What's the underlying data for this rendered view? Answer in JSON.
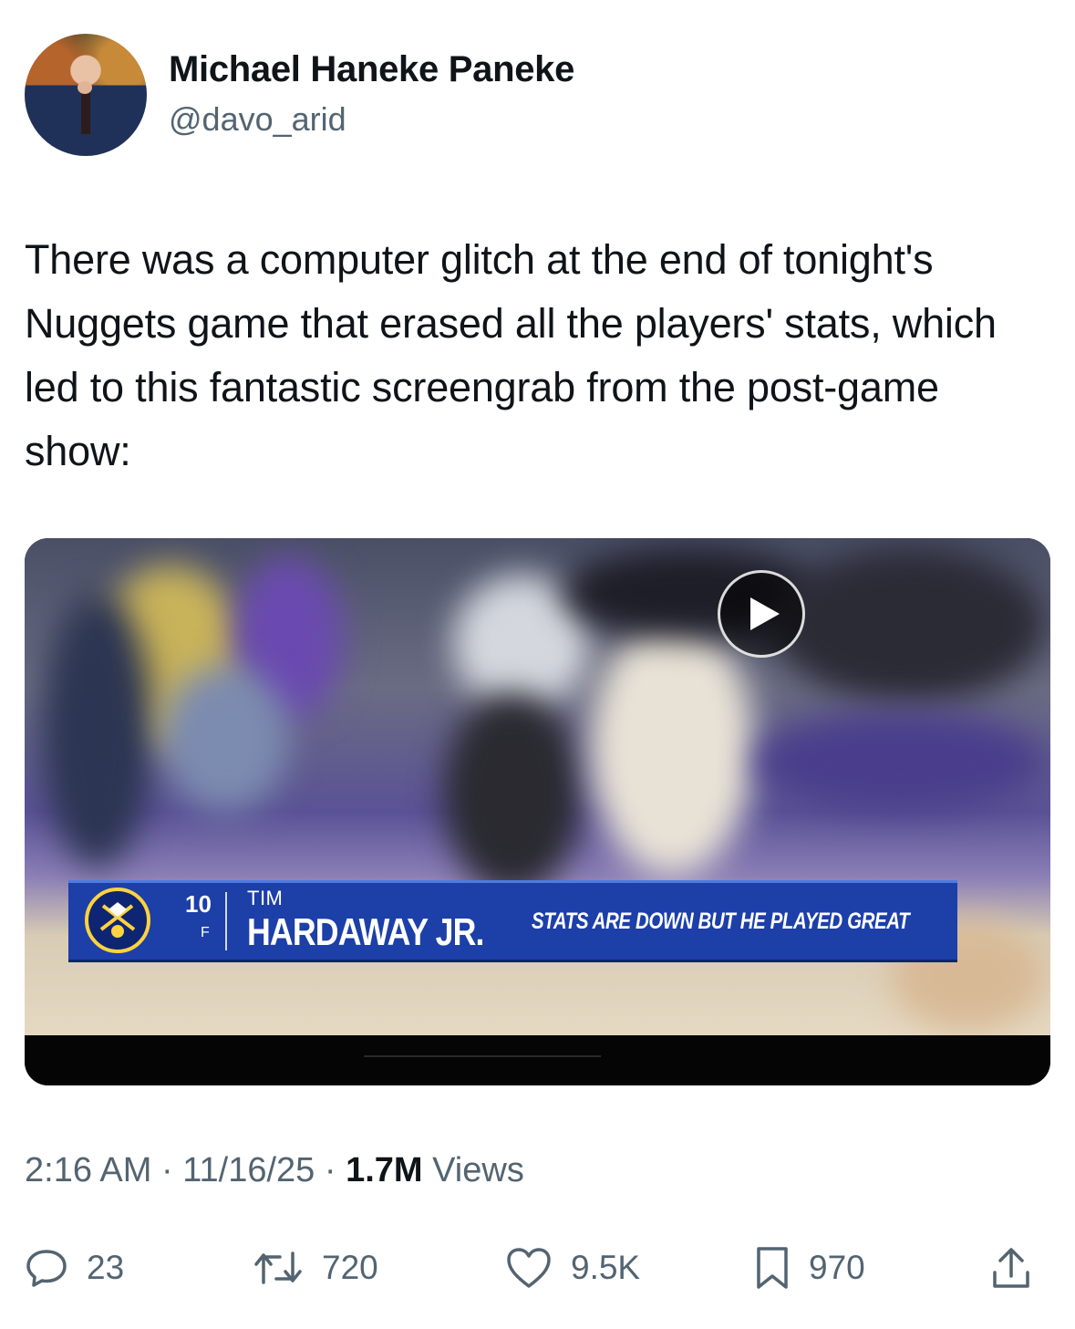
{
  "author": {
    "display_name": "Michael Haneke Paneke",
    "handle": "@davo_arid"
  },
  "tweet": {
    "text": "There was a computer glitch at the end of tonight's Nuggets game that erased all the players' stats, which led to this fantastic screengrab from the post-game show:"
  },
  "media": {
    "icon": "play-icon",
    "graphic": {
      "number": "10",
      "position": "F",
      "first_name": "TIM",
      "last_name": "HARDAWAY JR.",
      "message": "STATS ARE DOWN BUT HE PLAYED GREAT",
      "bar_color": "#1c3fa8",
      "logo_color": "#ffd23f"
    }
  },
  "meta": {
    "time": "2:16 AM",
    "sep1": " · ",
    "date": "11/16/25",
    "sep2": " · ",
    "views_count": "1.7M",
    "views_label": " Views"
  },
  "actions": {
    "reply_count": "23",
    "repost_count": "720",
    "like_count": "9.5K",
    "bookmark_count": "970",
    "icons": [
      "reply-icon",
      "repost-icon",
      "like-icon",
      "bookmark-icon",
      "share-icon"
    ]
  },
  "colors": {
    "text": "#0f1419",
    "secondary": "#536471"
  }
}
